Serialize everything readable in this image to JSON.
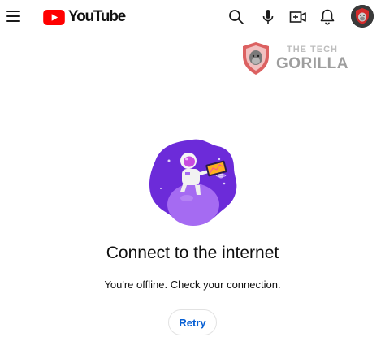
{
  "header": {
    "logo_text": "YouTube",
    "icons": [
      "menu-icon",
      "search-icon",
      "mic-icon",
      "create-icon",
      "notifications-icon",
      "account-avatar"
    ]
  },
  "watermark": {
    "line1": "THE TECH",
    "line2": "GORILLA"
  },
  "offline": {
    "title": "Connect to the internet",
    "message": "You're offline. Check your connection.",
    "retry_label": "Retry"
  },
  "colors": {
    "brand_red": "#ff0000",
    "link_blue": "#065fd4",
    "illustration_purple": "#6c2bd9"
  }
}
